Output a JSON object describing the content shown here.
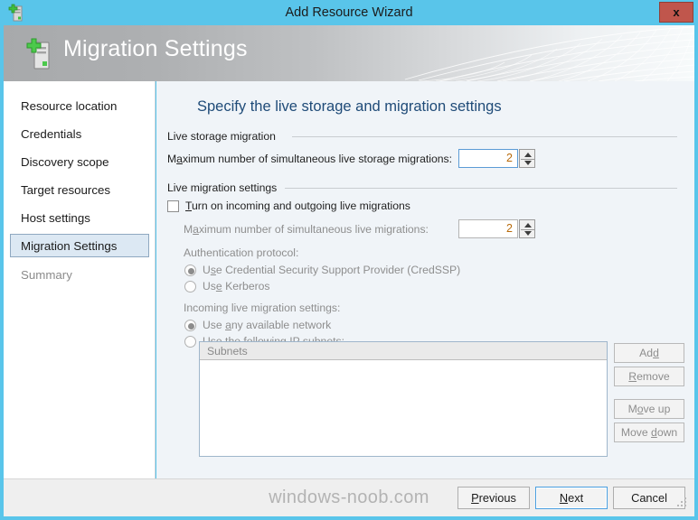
{
  "window": {
    "title": "Add Resource Wizard",
    "close_label": "x",
    "title_icon": "server-add-icon",
    "accent_color": "#59c5ea",
    "close_color": "#c0564c"
  },
  "banner": {
    "title": "Migration Settings",
    "icon": "server-add-icon"
  },
  "sidebar": {
    "items": [
      {
        "label": "Resource location",
        "state": "normal"
      },
      {
        "label": "Credentials",
        "state": "normal"
      },
      {
        "label": "Discovery scope",
        "state": "normal"
      },
      {
        "label": "Target resources",
        "state": "normal"
      },
      {
        "label": "Host settings",
        "state": "normal"
      },
      {
        "label": "Migration Settings",
        "state": "selected"
      },
      {
        "label": "Summary",
        "state": "disabled"
      }
    ]
  },
  "main": {
    "heading": "Specify the live storage and migration settings",
    "storage_group": {
      "label": "Live storage migration",
      "max_storage_label": "Maximum number of simultaneous live storage migrations:",
      "max_storage_label_pre": "M",
      "max_storage_label_key": "a",
      "max_storage_label_post": "ximum number of simultaneous live storage migrations:",
      "max_storage_value": "2"
    },
    "migration_group": {
      "label": "Live migration settings",
      "turn_on_pre": "",
      "turn_on_key": "T",
      "turn_on_post": "urn on incoming and outgoing live migrations",
      "turn_on_label": "Turn on incoming and outgoing live migrations",
      "turn_on_checked": false,
      "max_live_pre": "M",
      "max_live_key": "a",
      "max_live_post": "ximum number of simultaneous live migrations:",
      "max_live_label": "Maximum number of simultaneous live migrations:",
      "max_live_value": "2",
      "auth_label": "Authentication protocol:",
      "auth_options": [
        {
          "label": "Use Credential Security Support Provider (CredSSP)",
          "pre": "U",
          "key": "s",
          "post": "e Credential Security Support Provider (CredSSP)",
          "selected": true
        },
        {
          "label": "Use Kerberos",
          "pre": "Us",
          "key": "e",
          "post": " Kerberos",
          "selected": false
        }
      ],
      "incoming_label": "Incoming live migration settings:",
      "incoming_options": [
        {
          "label": "Use any available network",
          "pre": "Use ",
          "key": "a",
          "post": "ny available network",
          "selected": true
        },
        {
          "label": "Use the following IP subnets:",
          "pre": "Use t",
          "key": "h",
          "post": "e following IP subnets:",
          "selected": false
        }
      ],
      "subnets_column_header": "Subnets",
      "subnets_rows": [],
      "list_buttons": [
        {
          "label": "Add",
          "pre": "Ad",
          "key": "d",
          "post": ""
        },
        {
          "label": "Remove",
          "pre": "",
          "key": "R",
          "post": "emove"
        },
        {
          "label": "Move up",
          "pre": "M",
          "key": "o",
          "post": "ve up"
        },
        {
          "label": "Move down",
          "pre": "Move ",
          "key": "d",
          "post": "own"
        }
      ]
    }
  },
  "footer": {
    "buttons": [
      {
        "label": "Previous",
        "pre": "",
        "key": "P",
        "post": "revious",
        "default": false
      },
      {
        "label": "Next",
        "pre": "",
        "key": "N",
        "post": "ext",
        "default": true
      },
      {
        "label": "Cancel",
        "pre": "Cancel",
        "key": "",
        "post": "",
        "default": false
      }
    ]
  },
  "watermark": "windows-noob.com"
}
